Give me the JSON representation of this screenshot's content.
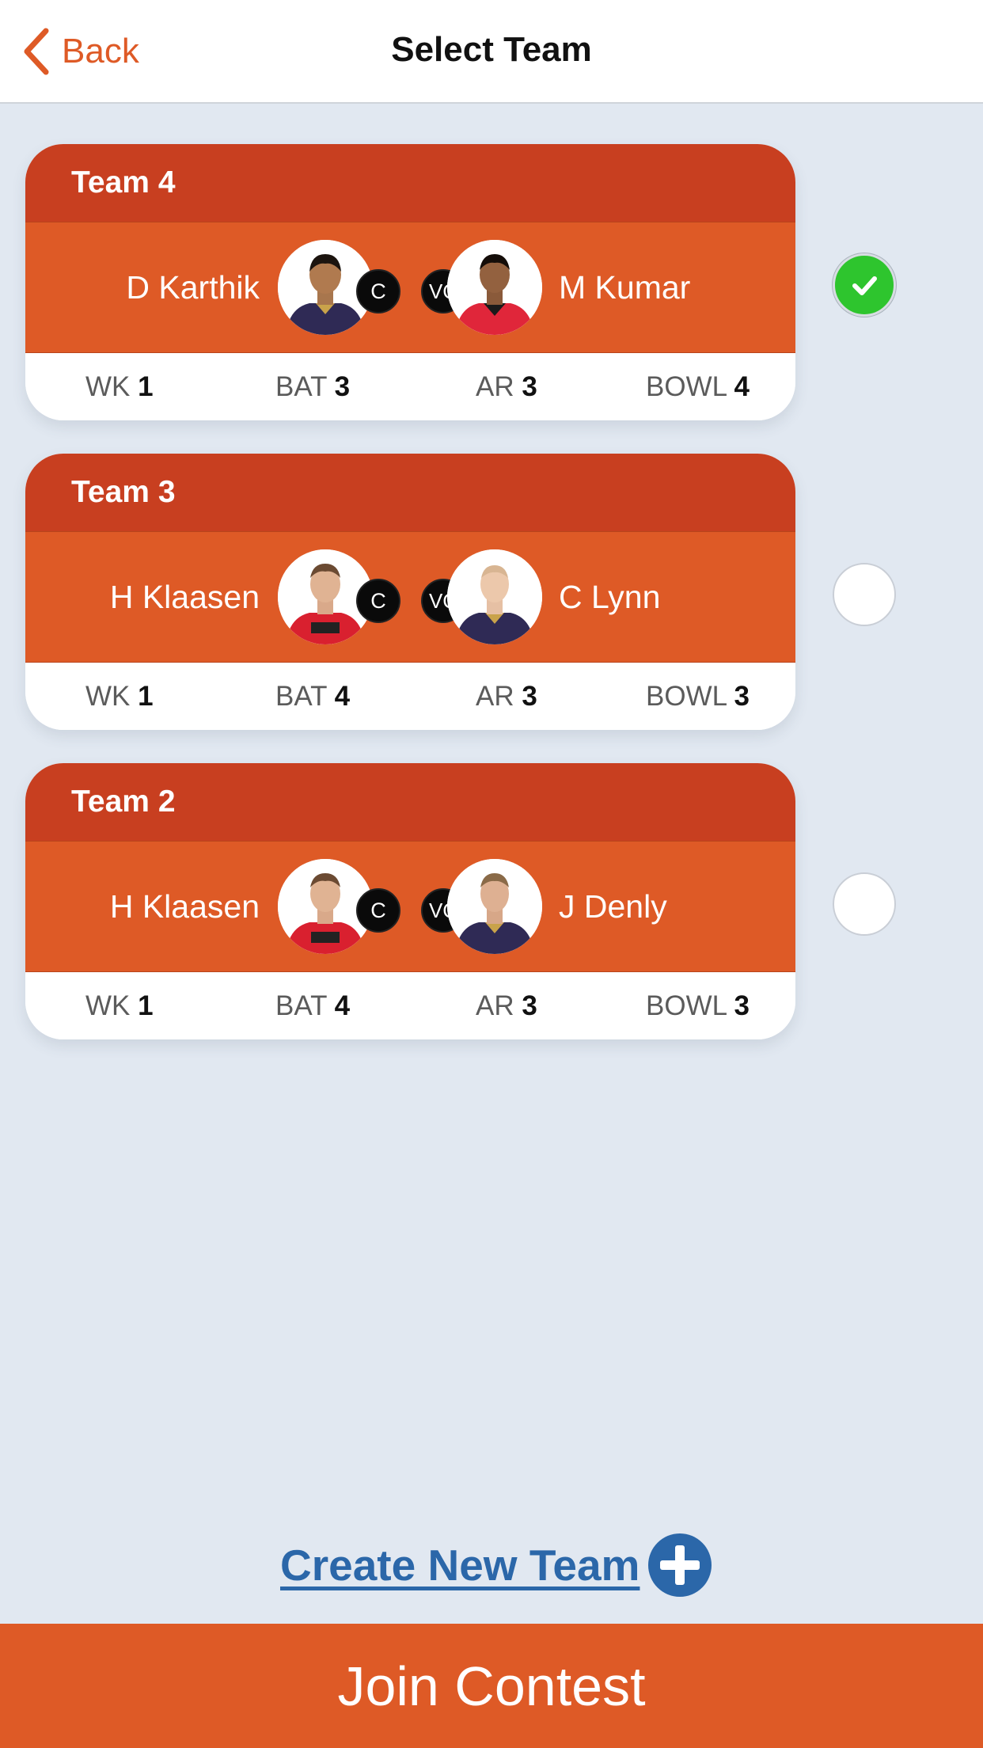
{
  "nav": {
    "back_label": "Back",
    "title": "Select Team"
  },
  "teams": [
    {
      "name": "Team 4",
      "captain": {
        "name": "D Karthik",
        "badge": "C",
        "jersey": "KKR"
      },
      "vice_captain": {
        "name": "M Kumar",
        "badge": "VC",
        "jersey": "RCB"
      },
      "stats": [
        {
          "label": "WK",
          "value": "1"
        },
        {
          "label": "BAT",
          "value": "3"
        },
        {
          "label": "AR",
          "value": "3"
        },
        {
          "label": "BOWL",
          "value": "4"
        }
      ],
      "selected": true
    },
    {
      "name": "Team 3",
      "captain": {
        "name": "H Klaasen",
        "badge": "C",
        "jersey": "RCB"
      },
      "vice_captain": {
        "name": "C Lynn",
        "badge": "VC",
        "jersey": "KKR"
      },
      "stats": [
        {
          "label": "WK",
          "value": "1"
        },
        {
          "label": "BAT",
          "value": "4"
        },
        {
          "label": "AR",
          "value": "3"
        },
        {
          "label": "BOWL",
          "value": "3"
        }
      ],
      "selected": false
    },
    {
      "name": "Team 2",
      "captain": {
        "name": "H Klaasen",
        "badge": "C",
        "jersey": "RCB"
      },
      "vice_captain": {
        "name": "J Denly",
        "badge": "VC",
        "jersey": "KKR"
      },
      "stats": [
        {
          "label": "WK",
          "value": "1"
        },
        {
          "label": "BAT",
          "value": "4"
        },
        {
          "label": "AR",
          "value": "3"
        },
        {
          "label": "BOWL",
          "value": "3"
        }
      ],
      "selected": false
    }
  ],
  "create_new_team_label": "Create New Team ",
  "join_contest_label": "Join Contest",
  "colors": {
    "accent": "#de5a26",
    "header_dark": "#c83f20",
    "link_blue": "#2b67a9",
    "check_green": "#2ec52e",
    "background": "#e1e8f1"
  }
}
